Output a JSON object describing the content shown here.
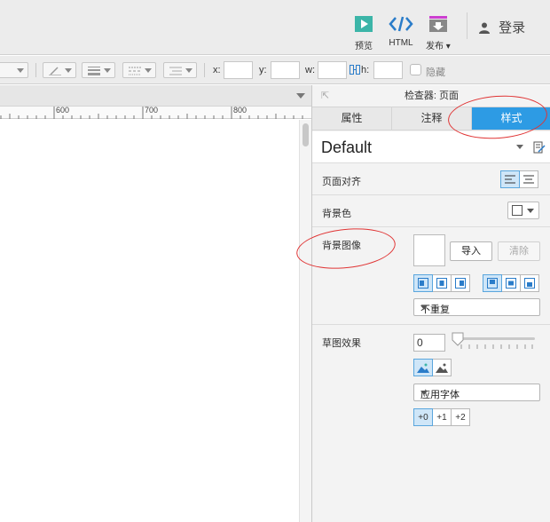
{
  "toolbar": {
    "preview_label": "预览",
    "html_label": "HTML",
    "publish_label": "发布",
    "publish_arrow": "▾",
    "login_label": "登录"
  },
  "toolbar2": {
    "x_label": "x:",
    "y_label": "y:",
    "w_label": "w:",
    "h_label": "h:",
    "hide_label": "隐藏"
  },
  "ruler": {
    "marks": [
      "600",
      "700",
      "800"
    ]
  },
  "inspector": {
    "title": "检查器: 页面",
    "tabs": [
      {
        "label": "属性"
      },
      {
        "label": "注释"
      },
      {
        "label": "样式",
        "active": true
      }
    ],
    "style_name": "Default",
    "page_align_label": "页面对齐",
    "bg_color_label": "背景色",
    "bg_image_label": "背景图像",
    "import_label": "导入",
    "clear_label": "清除",
    "repeat_value": "不重复",
    "sketch_label": "草图效果",
    "sketch_value": "0",
    "font_value": "应用字体",
    "line_widths": [
      "+0",
      "+1",
      "+2"
    ]
  },
  "colors": {
    "accent": "#2d9be4",
    "annotation": "#e03434",
    "preview_icon": "#3cb5a8",
    "publish_icon": "#cc3fd0"
  }
}
